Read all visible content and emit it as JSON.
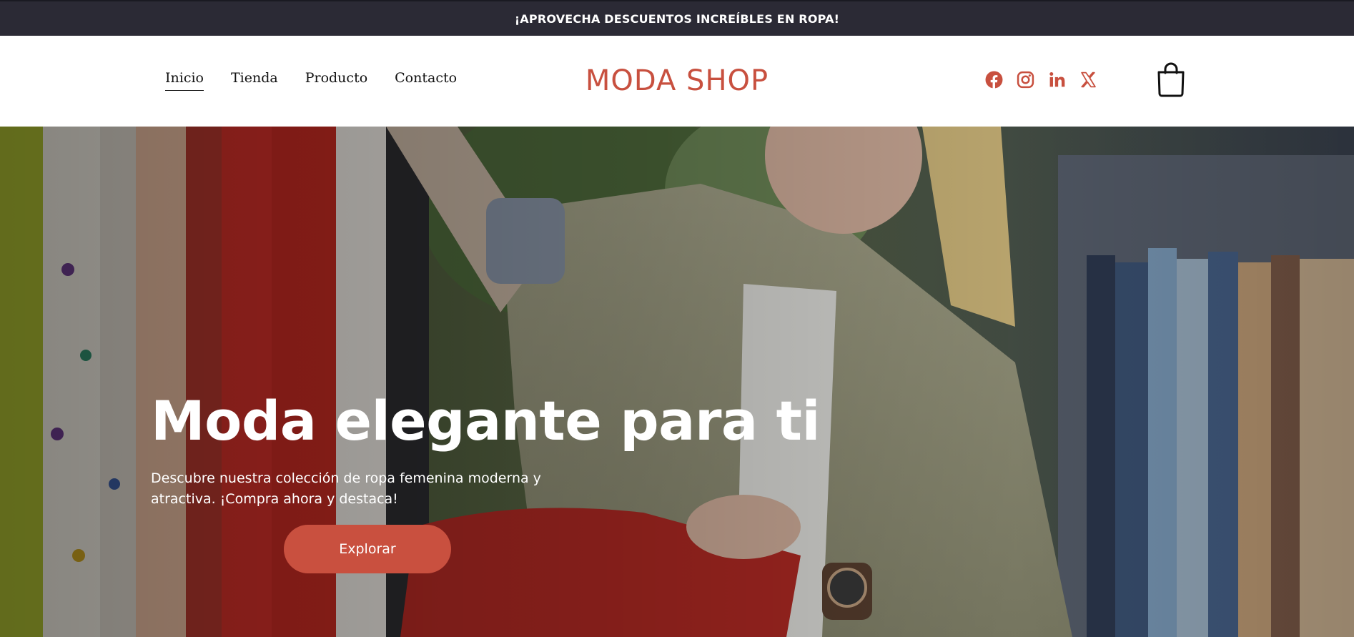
{
  "promo_bar": {
    "text": "¡APROVECHA DESCUENTOS INCREÍBLES EN ROPA!"
  },
  "header": {
    "nav": [
      {
        "label": "Inicio",
        "active": true
      },
      {
        "label": "Tienda",
        "active": false
      },
      {
        "label": "Producto",
        "active": false
      },
      {
        "label": "Contacto",
        "active": false
      }
    ],
    "logo": "MODA SHOP",
    "socials": [
      "facebook-icon",
      "instagram-icon",
      "linkedin-icon",
      "x-icon"
    ],
    "cart_icon": "shopping-bag-icon"
  },
  "hero": {
    "title": "Moda elegante para ti",
    "subtitle": "Descubre nuestra colección de ropa femenina moderna y atractiva. ¡Compra ahora y destaca!",
    "button_label": "Explorar"
  },
  "colors": {
    "accent": "#c8503f",
    "promo_background": "#2b2a35",
    "text_dark": "#111111"
  }
}
